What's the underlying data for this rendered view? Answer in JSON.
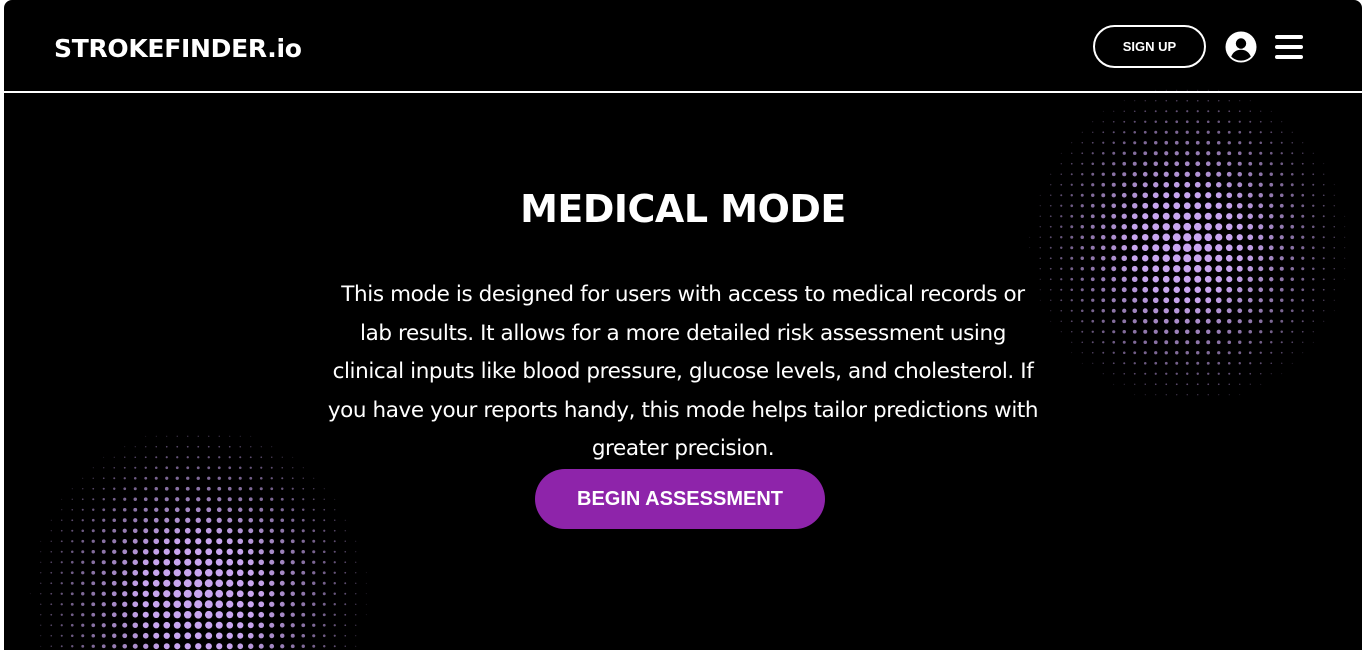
{
  "navbar": {
    "logo_text": "STROKEFINDER.io",
    "signup_label": "SIGN UP",
    "user_icon": "user-circle-icon",
    "menu_icon": "hamburger-menu-icon"
  },
  "hero": {
    "title": "MEDICAL MODE",
    "description": "This mode is designed for users with access to medical records or lab results. It allows for a more detailed risk assessment using clinical inputs like blood pressure, glucose levels, and cholesterol. If you have your reports handy, this mode helps tailor predictions with greater precision.",
    "cta_label": "BEGIN ASSESSMENT"
  },
  "colors": {
    "background": "#000000",
    "text": "#ffffff",
    "accent": "#8e24aa",
    "halftone": "#c9a6f0"
  }
}
